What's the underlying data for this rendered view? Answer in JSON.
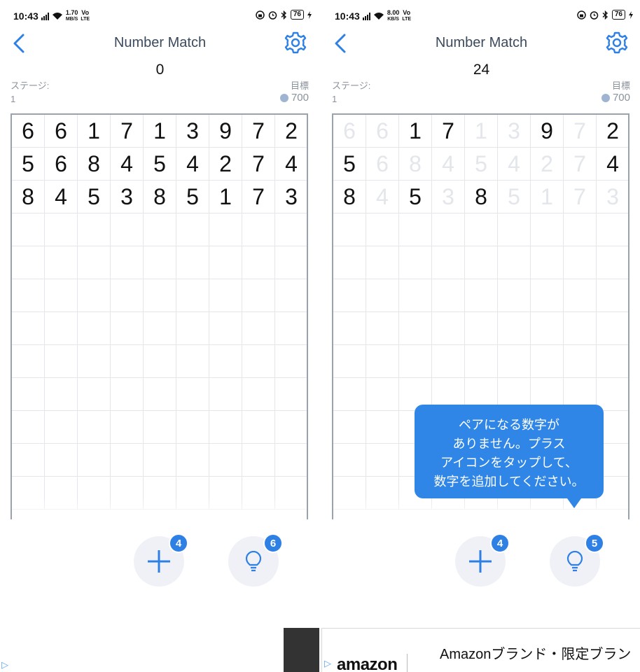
{
  "screens": [
    {
      "status": {
        "time": "10:43",
        "speed_value": "1.70",
        "speed_unit": "MB/S",
        "volte_top": "Vo",
        "volte_bottom": "LTE",
        "battery": "76"
      },
      "title": "Number Match",
      "score": "0",
      "stage_label": "ステージ:",
      "stage_value": "1",
      "goal_label": "目標",
      "goal_value": "700",
      "rows": [
        [
          "6",
          "6",
          "1",
          "7",
          "1",
          "3",
          "9",
          "7",
          "2"
        ],
        [
          "5",
          "6",
          "8",
          "4",
          "5",
          "4",
          "2",
          "7",
          "4"
        ],
        [
          "8",
          "4",
          "5",
          "3",
          "8",
          "5",
          "1",
          "7",
          "3"
        ]
      ],
      "crossed": [
        [
          false,
          false,
          false,
          false,
          false,
          false,
          false,
          false,
          false
        ],
        [
          false,
          false,
          false,
          false,
          false,
          false,
          false,
          false,
          false
        ],
        [
          false,
          false,
          false,
          false,
          false,
          false,
          false,
          false,
          false
        ]
      ],
      "add_badge": "4",
      "hint_badge": "6"
    },
    {
      "status": {
        "time": "10:43",
        "speed_value": "8.00",
        "speed_unit": "KB/S",
        "volte_top": "Vo",
        "volte_bottom": "LTE",
        "battery": "76"
      },
      "title": "Number Match",
      "score": "24",
      "stage_label": "ステージ:",
      "stage_value": "1",
      "goal_label": "目標",
      "goal_value": "700",
      "rows": [
        [
          "6",
          "6",
          "1",
          "7",
          "1",
          "3",
          "9",
          "7",
          "2"
        ],
        [
          "5",
          "6",
          "8",
          "4",
          "5",
          "4",
          "2",
          "7",
          "4"
        ],
        [
          "8",
          "4",
          "5",
          "3",
          "8",
          "5",
          "1",
          "7",
          "3"
        ]
      ],
      "crossed": [
        [
          true,
          true,
          false,
          false,
          true,
          true,
          false,
          true,
          false
        ],
        [
          false,
          true,
          true,
          true,
          true,
          true,
          true,
          true,
          false
        ],
        [
          false,
          true,
          false,
          true,
          false,
          true,
          true,
          true,
          true
        ]
      ],
      "add_badge": "4",
      "hint_badge": "5",
      "tooltip": [
        "ペアになる数字が",
        "ありません。プラス",
        "アイコンをタップして、",
        "数字を追加してください。"
      ]
    }
  ],
  "ad": {
    "brand": "amazon",
    "text": "Amazonブランド・限定ブラン"
  },
  "colors": {
    "accent": "#2f80e4",
    "tooltip": "#2f86e6",
    "crossed_digit": "#e3e6ea",
    "button_bg": "#eff1f6"
  }
}
